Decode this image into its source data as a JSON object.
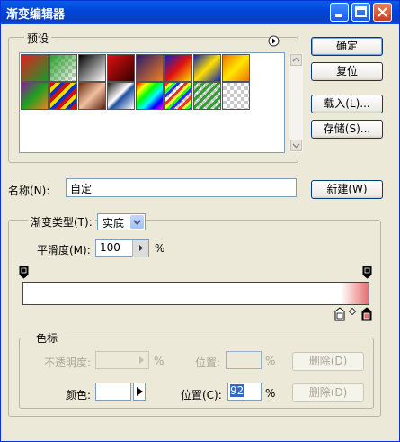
{
  "window": {
    "title": "渐变编辑器"
  },
  "presets": {
    "label": "预设",
    "menu_icon": "circle-arrow-icon",
    "items_row1": [
      "red-green",
      "green-checker",
      "black-white",
      "red-black",
      "purple-orange",
      "blue-red-yellow",
      "blue-yellow-blue",
      "orange-yellow-orange"
    ],
    "items_row2": [
      "violet-orange",
      "multi-stripe",
      "copper",
      "chrome",
      "spectrum",
      "transparent-rainbow",
      "transparent-stripes",
      "transparent"
    ]
  },
  "buttons": {
    "ok": "确定",
    "reset": "复位",
    "load": "载入(L)...",
    "save": "存储(S)...",
    "new": "新建(W)"
  },
  "name": {
    "label": "名称(N):",
    "value": "自定"
  },
  "gradient_type": {
    "label": "渐变类型(T):",
    "value": "实底"
  },
  "smoothness": {
    "label": "平滑度(M):",
    "value": "100",
    "unit": "%"
  },
  "color_stops": {
    "legend": "色标",
    "opacity_label": "不透明度:",
    "opacity_unit": "%",
    "location_label_top": "位置:",
    "location_unit_top": "%",
    "delete_top": "删除(D)",
    "color_label": "颜色:",
    "location_label": "位置(C):",
    "location_value": "92",
    "location_unit": "%",
    "delete_bottom": "删除(D)"
  },
  "gradient": {
    "colors": [
      "#ffffff",
      "#e07070"
    ],
    "selected_stop_location": 92
  },
  "colors": {
    "titlebar": "#0a4fd9",
    "face": "#ece9d8",
    "accent": "#316ac5"
  }
}
